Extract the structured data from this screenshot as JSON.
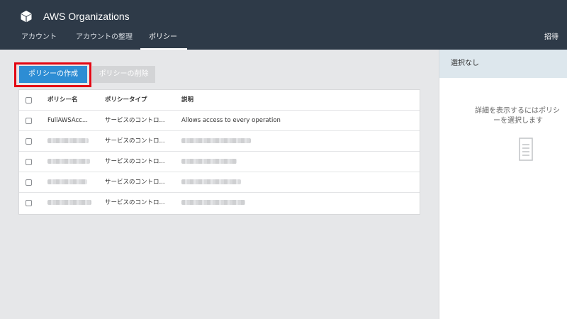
{
  "app": {
    "title": "AWS Organizations",
    "logo_icon": "cube-icon"
  },
  "nav": {
    "tabs": [
      {
        "label": "アカウント",
        "active": false
      },
      {
        "label": "アカウントの整理",
        "active": false
      },
      {
        "label": "ポリシー",
        "active": true
      }
    ],
    "invite_label": "招待"
  },
  "toolbar": {
    "create_label": "ポリシーの作成",
    "delete_label": "ポリシーの削除",
    "highlight_color": "#e30613",
    "primary_color": "#2d8dd4"
  },
  "table": {
    "headers": {
      "name": "ポリシー名",
      "type": "ポリシータイプ",
      "description": "説明"
    },
    "rows": [
      {
        "name": "FullAWSAcc...",
        "type": "サービスのコントロ...",
        "description": "Allows access to every operation"
      },
      {
        "name": "",
        "type": "サービスのコントロ...",
        "description": ""
      },
      {
        "name": "",
        "type": "サービスのコントロ...",
        "description": ""
      },
      {
        "name": "",
        "type": "サービスのコントロ...",
        "description": ""
      },
      {
        "name": "",
        "type": "サービスのコントロ...",
        "description": ""
      }
    ]
  },
  "detail_panel": {
    "header": "選択なし",
    "message_line1": "詳細を表示するにはポリシ",
    "message_line2": "ーを選択します",
    "icon": "document-icon",
    "header_color": "#dde7ed"
  },
  "colors": {
    "topbar": "#2e3a48",
    "background": "#e6e7e9"
  }
}
